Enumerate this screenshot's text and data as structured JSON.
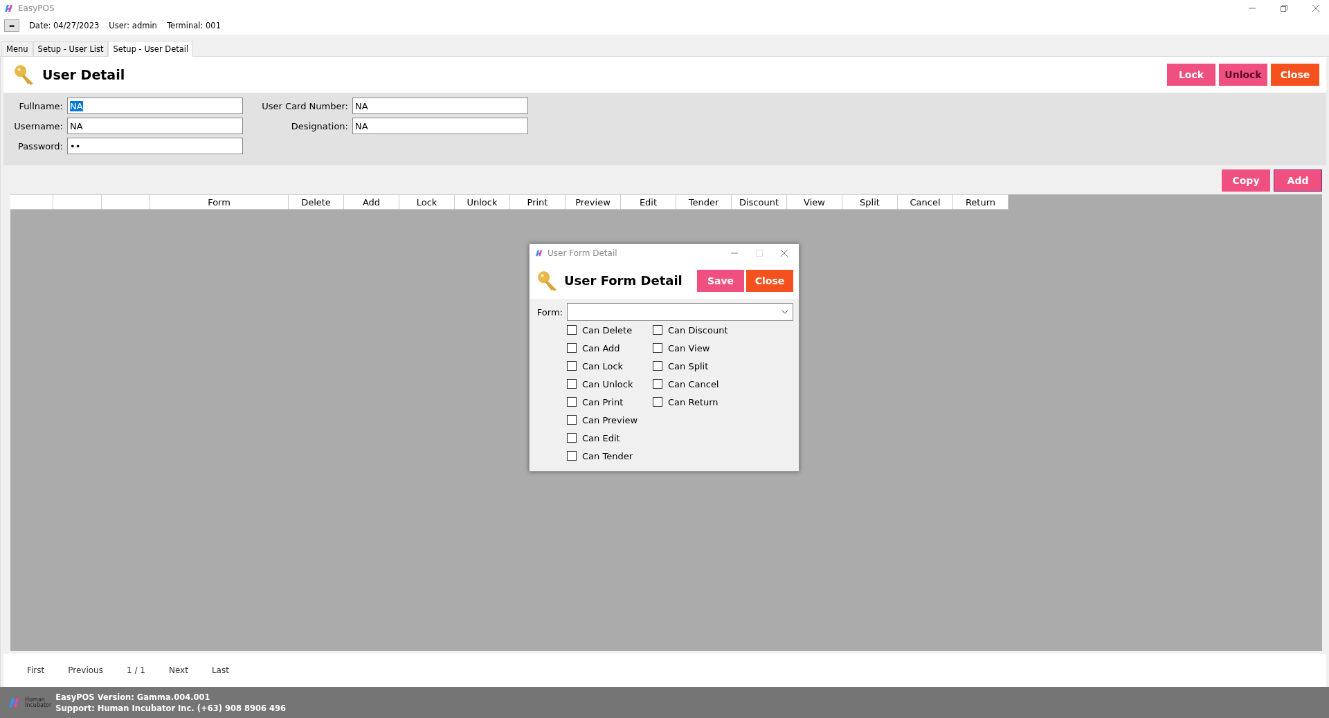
{
  "window": {
    "title": "EasyPOS"
  },
  "info_bar": {
    "menu_button": "=",
    "items": [
      "Date: 04/27/2023",
      "User: admin",
      "Terminal: 001"
    ]
  },
  "tabs": [
    {
      "label": "Menu",
      "selected": false
    },
    {
      "label": "Setup - User List",
      "selected": false
    },
    {
      "label": "Setup - User Detail",
      "selected": true
    }
  ],
  "header": {
    "title": "User Detail",
    "buttons": [
      {
        "label": "Lock",
        "color": "#f0507f",
        "hovered": false
      },
      {
        "label": "Unlock",
        "color": "#f0507f",
        "hovered": true
      },
      {
        "label": "Close",
        "color": "#f4511e",
        "hovered": false
      }
    ]
  },
  "fields_left": [
    {
      "label": "Fullname:",
      "value": "NA",
      "focused": true
    },
    {
      "label": "Username:",
      "value": "NA",
      "focused": false
    },
    {
      "label": "Password:",
      "value": "••",
      "focused": false
    }
  ],
  "fields_right": [
    {
      "label": "User Card Number:",
      "value": "NA",
      "focused": false
    },
    {
      "label": "Designation:",
      "value": "NA",
      "focused": false
    }
  ],
  "grid_buttons": [
    {
      "label": "Copy",
      "color": "#f0507f",
      "focused": false
    },
    {
      "label": "Add",
      "color": "#f0507f",
      "focused": true
    }
  ],
  "table": {
    "columns": [
      "",
      "",
      "",
      "Form",
      "Delete",
      "Add",
      "Lock",
      "Unlock",
      "Print",
      "Preview",
      "Edit",
      "Tender",
      "Discount",
      "View",
      "Split",
      "Cancel",
      "Return"
    ]
  },
  "pager": {
    "first": "First",
    "previous": "Previous",
    "page": "1 / 1",
    "next": "Next",
    "last": "Last"
  },
  "status_bar": {
    "logo_text": [
      "Human",
      "Incubator"
    ],
    "lines": [
      "EasyPOS Version: Gamma.004.001",
      "Support: Human Incubator Inc. (+63) 908 8906 496"
    ]
  },
  "dialog": {
    "title": "User Form Detail",
    "heading": "User Form Detail",
    "buttons": [
      {
        "label": "Save",
        "color": "#f0507f"
      },
      {
        "label": "Close",
        "color": "#f4511e"
      }
    ],
    "form_label": "Form:",
    "checkbox_columns": [
      [
        {
          "label": "Can Delete",
          "checked": false
        },
        {
          "label": "Can Add",
          "checked": false
        },
        {
          "label": "Can Lock",
          "checked": false
        },
        {
          "label": "Can Unlock",
          "checked": false
        },
        {
          "label": "Can Print",
          "checked": false
        },
        {
          "label": "Can Preview",
          "checked": false
        },
        {
          "label": "Can Edit",
          "checked": false
        },
        {
          "label": "Can Tender",
          "checked": false
        }
      ],
      [
        {
          "label": "Can Discount",
          "checked": false
        },
        {
          "label": "Can View",
          "checked": false
        },
        {
          "label": "Can Split",
          "checked": false
        },
        {
          "label": "Can Cancel",
          "checked": false
        },
        {
          "label": "Can Return",
          "checked": false
        }
      ]
    ]
  }
}
